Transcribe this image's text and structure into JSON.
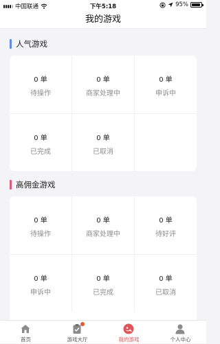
{
  "status_bar": {
    "carrier": "中国联通",
    "time": "下午5:18",
    "battery": "95%",
    "battery_level": 0.95
  },
  "header": {
    "title": "我的游戏"
  },
  "sections": [
    {
      "title": "人气游戏",
      "accent": "#5b8def",
      "items": [
        {
          "count": "0 单",
          "label": "待操作"
        },
        {
          "count": "0 单",
          "label": "商家处理中"
        },
        {
          "count": "0 单",
          "label": "申诉中"
        },
        {
          "count": "0 单",
          "label": "已完成"
        },
        {
          "count": "0 单",
          "label": "已取消"
        }
      ]
    },
    {
      "title": "高佣金游戏",
      "accent": "#e05a7a",
      "items": [
        {
          "count": "0 单",
          "label": "待操作"
        },
        {
          "count": "0 单",
          "label": "商家处理中"
        },
        {
          "count": "0 单",
          "label": "待好评"
        },
        {
          "count": "0 单",
          "label": "申诉中"
        },
        {
          "count": "0 单",
          "label": "已完成"
        },
        {
          "count": "0 单",
          "label": "已取消"
        }
      ]
    }
  ],
  "tab_bar": {
    "tabs": [
      {
        "label": "首页",
        "icon": "home-icon",
        "active": false
      },
      {
        "label": "游戏大厅",
        "icon": "clipboard-icon",
        "active": false,
        "badge": true
      },
      {
        "label": "我的游戏",
        "icon": "game-icon",
        "active": true
      },
      {
        "label": "个人中心",
        "icon": "person-icon",
        "active": false
      }
    ]
  },
  "colors": {
    "accent_active": "#e0555a",
    "badge": "#e05a3a"
  }
}
